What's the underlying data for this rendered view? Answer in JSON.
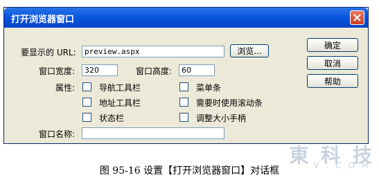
{
  "window": {
    "title": "打开浏览器窗口",
    "close_icon": "close-icon"
  },
  "form": {
    "url_label": "要显示的 URL:",
    "url_value": "preview.aspx",
    "browse_label": "浏览...",
    "width_label": "窗口宽度:",
    "width_value": "320",
    "height_label": "窗口高度:",
    "height_value": "60",
    "attributes_label": "属性:",
    "checkboxes": [
      {
        "label": "导航工具栏",
        "checked": false
      },
      {
        "label": "菜单条",
        "checked": false
      },
      {
        "label": "地址工具栏",
        "checked": false
      },
      {
        "label": "需要时使用滚动条",
        "checked": false
      },
      {
        "label": "状态栏",
        "checked": false
      },
      {
        "label": "调整大小手柄",
        "checked": false
      }
    ],
    "name_label": "窗口名称:",
    "name_value": ""
  },
  "buttons": {
    "ok": "确定",
    "cancel": "取消",
    "help": "帮助"
  },
  "caption": "图 95-16   设置【打开浏览器窗口】对话框",
  "watermark": "東 科 技",
  "watermark_sub": "V . C O M",
  "colors": {
    "titlebar": "#0a58e0",
    "dialog_bg": "#ece9d8",
    "input_border": "#7f9db9",
    "close_button": "#e2583e"
  }
}
